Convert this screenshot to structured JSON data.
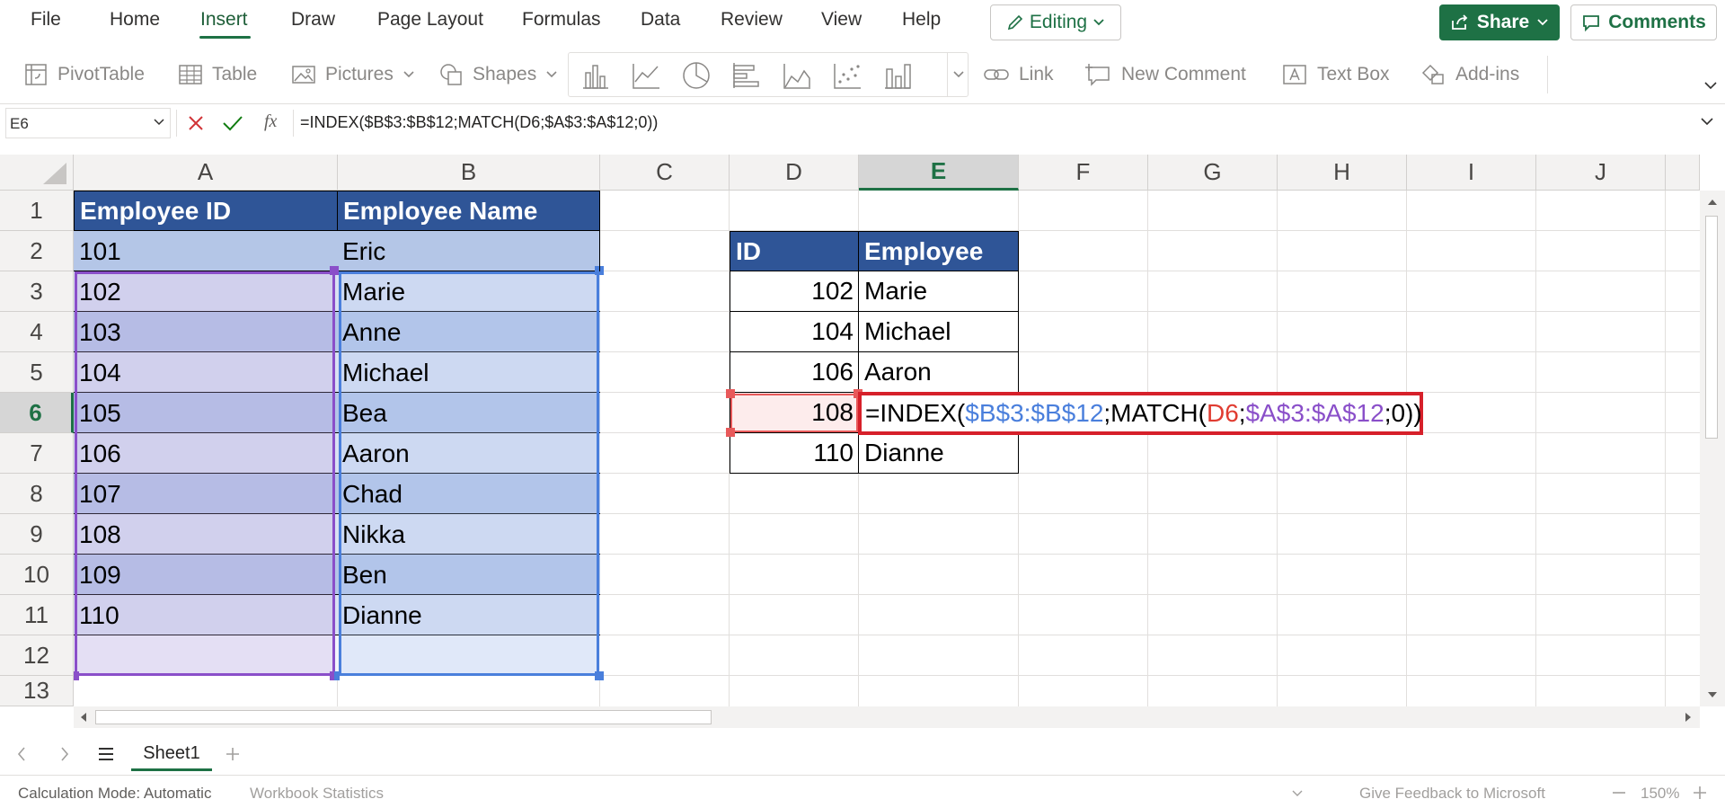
{
  "tabs": [
    "File",
    "Home",
    "Insert",
    "Draw",
    "Page Layout",
    "Formulas",
    "Data",
    "Review",
    "View",
    "Help"
  ],
  "active_tab": "Insert",
  "editing_label": "Editing",
  "share_label": "Share",
  "comments_label": "Comments",
  "ribbon": {
    "pivottable": "PivotTable",
    "table": "Table",
    "pictures": "Pictures",
    "shapes": "Shapes",
    "link": "Link",
    "new_comment": "New Comment",
    "text_box": "Text Box",
    "addins": "Add-ins",
    "chart_icons": [
      "column-chart-icon",
      "line-chart-icon",
      "pie-chart-icon",
      "bar-chart-icon",
      "area-chart-icon",
      "scatter-chart-icon",
      "other-chart-icon"
    ]
  },
  "formula_bar": {
    "name_box": "E6",
    "fx": "fx",
    "formula": "=INDEX($B$3:$B$12;MATCH(D6;$A$3:$A$12;0))"
  },
  "columns": [
    "A",
    "B",
    "C",
    "D",
    "E",
    "F",
    "G",
    "H",
    "I",
    "J"
  ],
  "selected_column": "E",
  "rows": [
    "1",
    "2",
    "3",
    "4",
    "5",
    "6",
    "7",
    "8",
    "9",
    "10",
    "11",
    "12",
    "13"
  ],
  "selected_row": "6",
  "table1": {
    "headers": [
      "Employee ID",
      "Employee Name"
    ],
    "rows": [
      [
        "101",
        "Eric"
      ],
      [
        "102",
        "Marie"
      ],
      [
        "103",
        "Anne"
      ],
      [
        "104",
        "Michael"
      ],
      [
        "105",
        "Bea"
      ],
      [
        "106",
        "Aaron"
      ],
      [
        "107",
        "Chad"
      ],
      [
        "108",
        "Nikka"
      ],
      [
        "109",
        "Ben"
      ],
      [
        "110",
        "Dianne"
      ]
    ]
  },
  "table2": {
    "headers": [
      "ID",
      "Employee"
    ],
    "rows": [
      [
        "102",
        "Marie"
      ],
      [
        "104",
        "Michael"
      ],
      [
        "106",
        "Aaron"
      ],
      [
        "108",
        ""
      ],
      [
        "110",
        "Dianne"
      ]
    ]
  },
  "edit_cell": {
    "parts": [
      "=INDEX(",
      "$B$3:$B$12",
      ";MATCH(",
      "D6",
      ";",
      "$A$3:$A$12",
      ";0))"
    ],
    "colors": {
      "default": "#000000",
      "range_b": "#4a7fdc",
      "d6": "#e03c31",
      "range_a": "#8a4fc9"
    }
  },
  "sheets": [
    "Sheet1"
  ],
  "status": {
    "calc_mode": "Calculation Mode: Automatic",
    "workbook_stats": "Workbook Statistics",
    "feedback": "Give Feedback to Microsoft",
    "zoom": "150%"
  },
  "colors": {
    "accent": "#1e7145",
    "table_header": "#2f5597",
    "table1_band_dark": "#b4c6e7",
    "table1_band_light": "#d9e1f2"
  }
}
